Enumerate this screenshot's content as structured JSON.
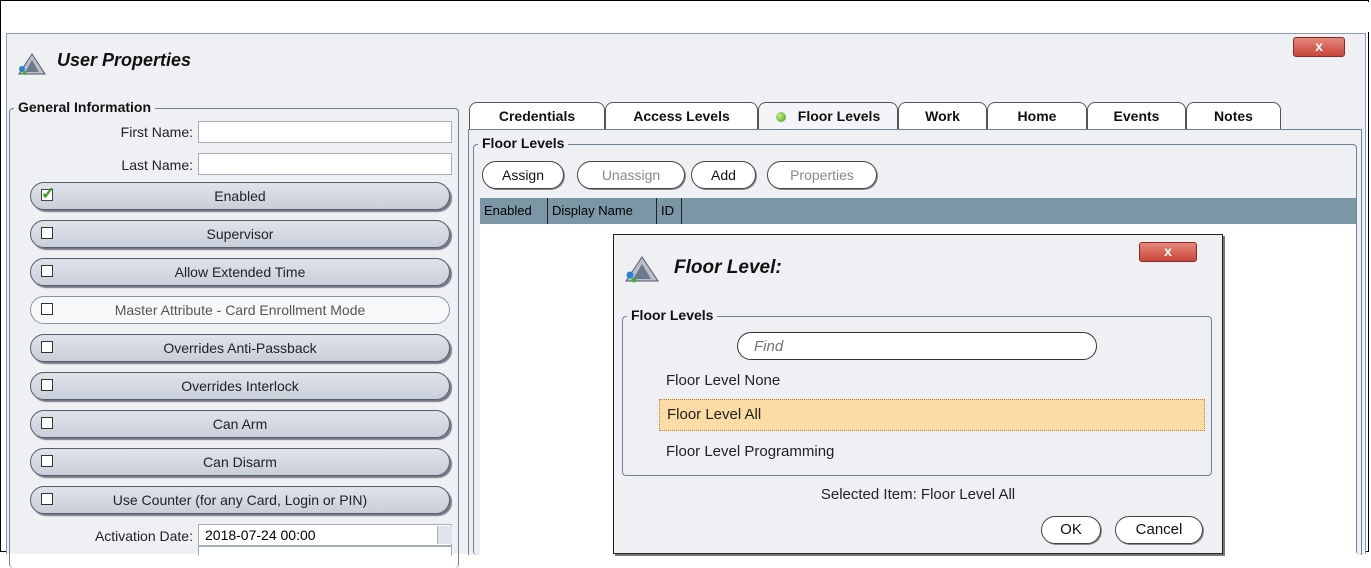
{
  "window": {
    "title": "User Properties",
    "close_label": "x"
  },
  "general": {
    "legend": "General Information",
    "first_name_label": "First Name:",
    "first_name_value": "",
    "last_name_label": "Last Name:",
    "last_name_value": "",
    "toggles": [
      {
        "label": "Enabled",
        "checked": true
      },
      {
        "label": "Supervisor",
        "checked": false
      },
      {
        "label": "Allow Extended Time",
        "checked": false
      },
      {
        "label": "Master Attribute - Card Enrollment Mode",
        "checked": false,
        "disabled": true
      },
      {
        "label": "Overrides Anti-Passback",
        "checked": false
      },
      {
        "label": "Overrides Interlock",
        "checked": false
      },
      {
        "label": "Can Arm",
        "checked": false
      },
      {
        "label": "Can Disarm",
        "checked": false
      },
      {
        "label": "Use Counter (for any Card, Login or PIN)",
        "checked": false
      }
    ],
    "activation_label": "Activation Date:",
    "activation_value": "2018-07-24 00:00"
  },
  "tabs": [
    {
      "label": "Credentials"
    },
    {
      "label": "Access Levels"
    },
    {
      "label": "Floor Levels",
      "active": true
    },
    {
      "label": "Work"
    },
    {
      "label": "Home"
    },
    {
      "label": "Events"
    },
    {
      "label": "Notes"
    }
  ],
  "floor_panel": {
    "legend": "Floor Levels",
    "buttons": {
      "assign": "Assign",
      "unassign": "Unassign",
      "add": "Add",
      "properties": "Properties"
    },
    "columns": [
      "Enabled",
      "Display Name",
      "ID"
    ]
  },
  "modal": {
    "title": "Floor Level:",
    "close_label": "x",
    "legend": "Floor Levels",
    "find_placeholder": "Find",
    "items": [
      "Floor Level None",
      "Floor Level All",
      "Floor Level Programming"
    ],
    "selected_index": 1,
    "selected_text": "Selected Item: Floor Level All",
    "ok_label": "OK",
    "cancel_label": "Cancel"
  }
}
